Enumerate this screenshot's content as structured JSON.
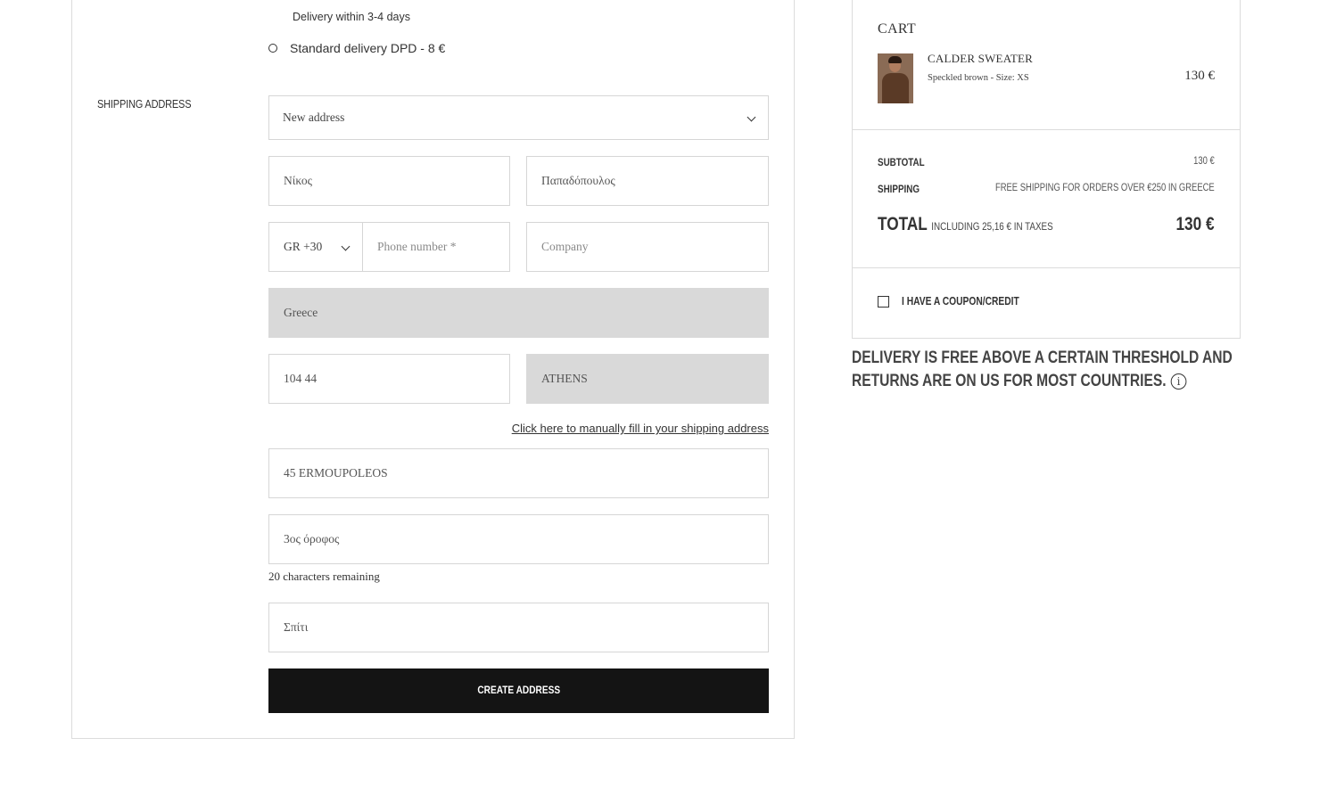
{
  "delivery": {
    "note": "Delivery within 3-4 days",
    "standard_option": "Standard delivery DPD - 8 €"
  },
  "shipping": {
    "section_label": "SHIPPING ADDRESS",
    "address_select": "New address",
    "first_name": "Νίκος",
    "last_name": "Παπαδόπουλος",
    "phone_country": "GR +30",
    "phone_placeholder": "Phone number *",
    "company_placeholder": "Company",
    "country": "Greece",
    "postal_code": "104 44",
    "city": "ATHENS",
    "manual_link": "Click here to manually fill in your shipping address",
    "street": "45 ERMOUPOLEOS",
    "address_line2": "3ος όροφος",
    "chars_remaining": "20 characters remaining",
    "address_name": "Σπίτι",
    "create_button": "CREATE ADDRESS"
  },
  "cart": {
    "title": "CART",
    "item": {
      "name": "CALDER SWEATER",
      "details": "Speckled brown - Size: XS",
      "price": "130 €"
    },
    "subtotal_label": "SUBTOTAL",
    "subtotal_value": "130 €",
    "shipping_label": "SHIPPING",
    "shipping_value": "FREE SHIPPING FOR ORDERS OVER €250 IN GREECE",
    "total_label": "TOTAL",
    "total_tax_note": "INCLUDING 25,16 € IN TAXES",
    "total_value": "130 €",
    "coupon_label": "I HAVE A COUPON/CREDIT"
  },
  "promo": {
    "text": "DELIVERY IS FREE ABOVE A CERTAIN THRESHOLD AND RETURNS ARE ON US FOR MOST COUNTRIES.",
    "icon": "info-icon"
  }
}
